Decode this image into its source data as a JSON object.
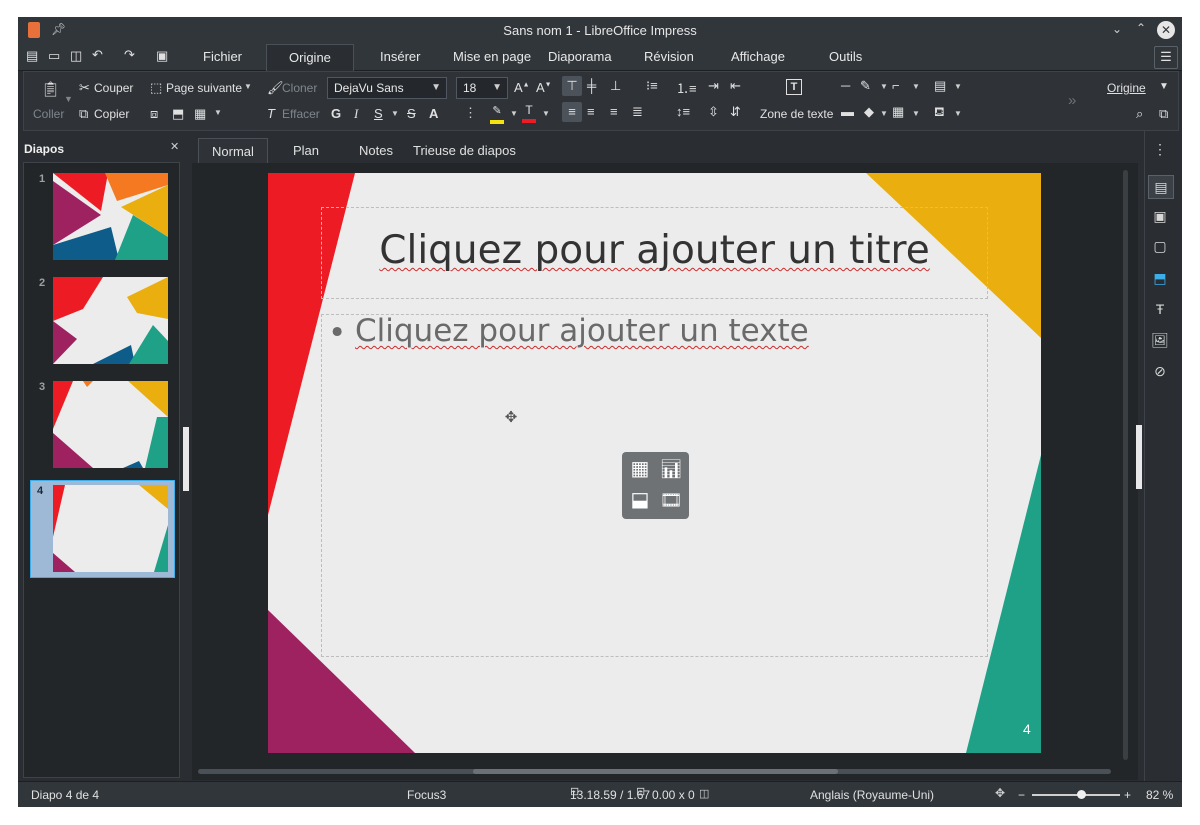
{
  "window": {
    "title": "Sans nom 1 - LibreOffice Impress"
  },
  "menu": [
    "Fichier",
    "Origine",
    "Insérer",
    "Mise en page",
    "Diaporama",
    "Révision",
    "Affichage",
    "Outils"
  ],
  "ribbon": {
    "coller": "Coller",
    "couper": "Couper",
    "copier": "Copier",
    "page_suivante": "Page suivante",
    "cloner": "Cloner",
    "effacer": "Effacer",
    "font_name": "DejaVu Sans",
    "font_size": "18",
    "zone_de_texte": "Zone de texte",
    "origine_dropdown": "Origine"
  },
  "slides_panel": {
    "title": "Diapos",
    "numbers": [
      "1",
      "2",
      "3",
      "4"
    ]
  },
  "view_tabs": [
    "Normal",
    "Plan",
    "Notes",
    "Trieuse de diapos"
  ],
  "slide": {
    "title_placeholder": "Cliquez pour ajouter un titre",
    "bullet": "•",
    "text_placeholder": "Cliquez pour ajouter un texte",
    "page_number": "4"
  },
  "status": {
    "slide": "Diapo 4 de 4",
    "master": "Focus3",
    "position": "13.18.59 / 1.67",
    "size": "0.00 x 0",
    "language": "Anglais (Royaume-Uni)",
    "zoom_minus": "−",
    "zoom_plus": "+",
    "zoom_level": "82 %",
    "zoom_fraction": 0.55
  },
  "colors": {
    "accent_blue": "#3daee9",
    "red": "#ed1c24",
    "orange": "#f47920",
    "yellow": "#eaaf0f",
    "purple": "#9e2260",
    "teal": "#1fa187",
    "navy": "#0d5c8a"
  }
}
